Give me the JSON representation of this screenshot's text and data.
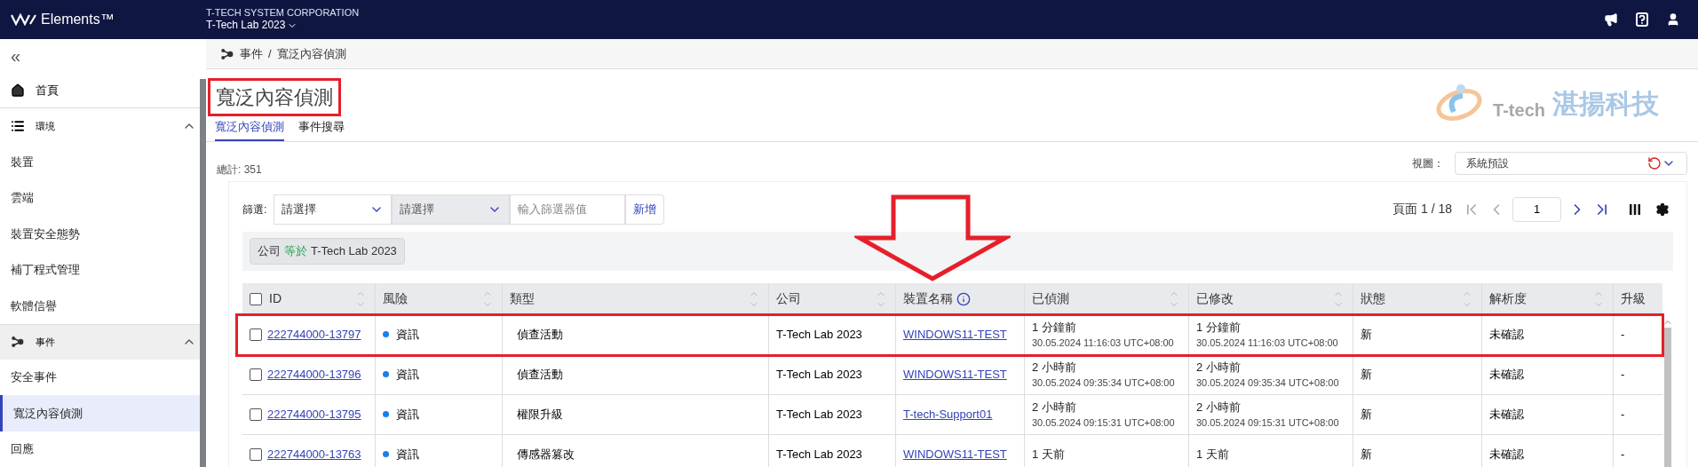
{
  "topbar": {
    "brand": "Elements™",
    "org": "T-TECH SYSTEM CORPORATION",
    "tenant": "T-Tech Lab 2023"
  },
  "sidebar": {
    "collapse": "«",
    "items": [
      {
        "kind": "link",
        "label": "首頁",
        "selected": false
      },
      {
        "kind": "section",
        "label": "環境",
        "expanded": true,
        "children": [
          {
            "label": "裝置",
            "selected": false
          },
          {
            "label": "雲端",
            "selected": false
          },
          {
            "label": "裝置安全態勢",
            "selected": false
          },
          {
            "label": "補丁程式管理",
            "selected": false
          },
          {
            "label": "軟體信譽",
            "selected": false
          }
        ]
      },
      {
        "kind": "section",
        "label": "事件",
        "expanded": true,
        "children": [
          {
            "label": "安全事件",
            "selected": false
          },
          {
            "label": "寬泛內容偵測",
            "selected": true
          },
          {
            "label": "回應",
            "selected": false
          }
        ]
      }
    ]
  },
  "breadcrumb": {
    "items": [
      "事件",
      "寬泛內容偵測"
    ],
    "separator": "/"
  },
  "title": {
    "text": "寬泛內容偵測",
    "highlighted": true
  },
  "tabs": [
    {
      "label": "寬泛內容偵測",
      "selected": true
    },
    {
      "label": "事件搜尋",
      "selected": false
    }
  ],
  "logo": {
    "mark": "T-tech",
    "name": "湛揚科技"
  },
  "total": "總計: 351",
  "view": {
    "label": "視圖：",
    "value": "系統預設"
  },
  "filter": {
    "label": "篩選:",
    "selects": [
      {
        "value": "請選擇",
        "disabled": false
      },
      {
        "value": "請選擇",
        "disabled": true
      }
    ],
    "placeholder": "輸入篩選器值",
    "add": "新增"
  },
  "pagination": {
    "label": "頁面 1 / 18",
    "page": "1"
  },
  "chips": [
    {
      "field": "公司",
      "op": "等於",
      "value": "T-Tech Lab 2023"
    }
  ],
  "table": {
    "all_checked": false,
    "columns": [
      {
        "label": "ID",
        "sortable": true,
        "info": false
      },
      {
        "label": "風險",
        "sortable": true,
        "info": false
      },
      {
        "label": "類型",
        "sortable": true,
        "info": false
      },
      {
        "label": "公司",
        "sortable": true,
        "info": false
      },
      {
        "label": "裝置名稱",
        "sortable": false,
        "info": true
      },
      {
        "label": "已偵測",
        "sortable": true,
        "info": false
      },
      {
        "label": "已修改",
        "sortable": true,
        "info": false
      },
      {
        "label": "狀態",
        "sortable": true,
        "info": false
      },
      {
        "label": "解析度",
        "sortable": true,
        "info": false
      },
      {
        "label": "升級",
        "sortable": false,
        "info": false
      }
    ],
    "rows": [
      {
        "checked": false,
        "highlighted": true,
        "id": "222744000-13797",
        "risk": "資訊",
        "type": "偵查活動",
        "company": "T-Tech Lab 2023",
        "device": "WINDOWS11-TEST",
        "detected": {
          "ago": "1 分鐘前",
          "time": "30.05.2024 11:16:03 UTC+08:00"
        },
        "modified": {
          "ago": "1 分鐘前",
          "time": "30.05.2024 11:16:03 UTC+08:00"
        },
        "status": "新",
        "resolution": "未確認",
        "escalation": "-"
      },
      {
        "checked": false,
        "highlighted": false,
        "id": "222744000-13796",
        "risk": "資訊",
        "type": "偵查活動",
        "company": "T-Tech Lab 2023",
        "device": "WINDOWS11-TEST",
        "detected": {
          "ago": "2 小時前",
          "time": "30.05.2024 09:35:34 UTC+08:00"
        },
        "modified": {
          "ago": "2 小時前",
          "time": "30.05.2024 09:35:34 UTC+08:00"
        },
        "status": "新",
        "resolution": "未確認",
        "escalation": "-"
      },
      {
        "checked": false,
        "highlighted": false,
        "id": "222744000-13795",
        "risk": "資訊",
        "type": "權限升級",
        "company": "T-Tech Lab 2023",
        "device": "T-tech-Support01",
        "detected": {
          "ago": "2 小時前",
          "time": "30.05.2024 09:15:31 UTC+08:00"
        },
        "modified": {
          "ago": "2 小時前",
          "time": "30.05.2024 09:15:31 UTC+08:00"
        },
        "status": "新",
        "resolution": "未確認",
        "escalation": "-"
      },
      {
        "checked": false,
        "highlighted": false,
        "id": "222744000-13763",
        "risk": "資訊",
        "type": "傳感器篡改",
        "company": "T-Tech Lab 2023",
        "device": "WINDOWS11-TEST",
        "detected": {
          "ago": "1 天前"
        },
        "modified": {
          "ago": "1 天前"
        },
        "status": "新",
        "resolution": "未確認",
        "escalation": "-"
      }
    ]
  }
}
